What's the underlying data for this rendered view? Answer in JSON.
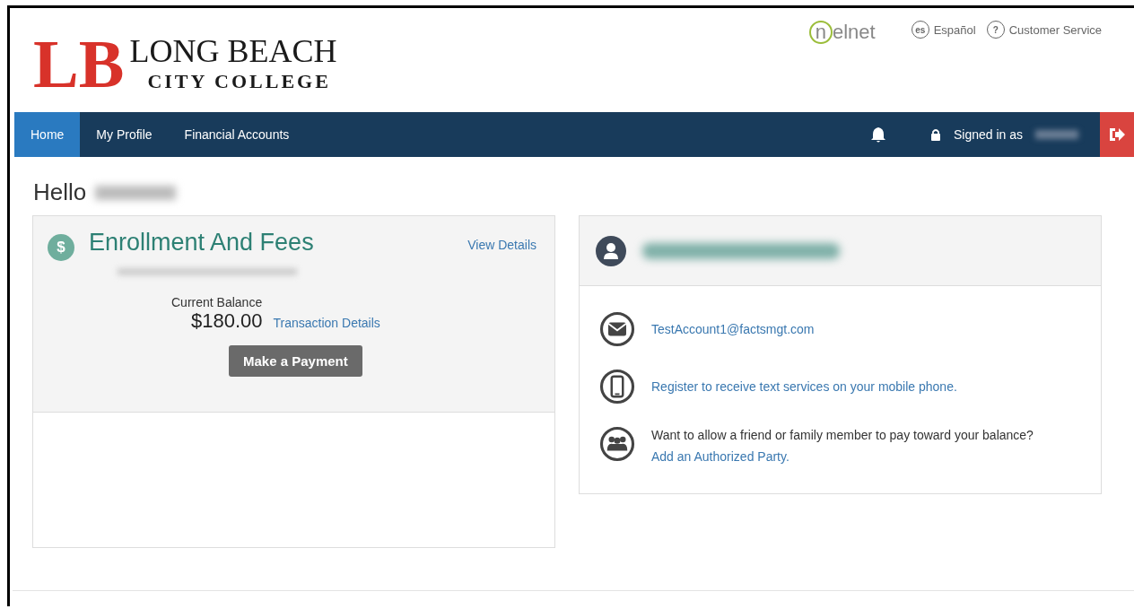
{
  "header": {
    "monogram": "LB",
    "college_name": "LONG BEACH",
    "college_sub": "CITY COLLEGE",
    "partner_logo": {
      "circle_letter": "n",
      "rest": "elnet"
    },
    "links": [
      {
        "badge": "es",
        "label": "Español"
      },
      {
        "badge": "?",
        "label": "Customer Service"
      }
    ]
  },
  "nav": {
    "items": [
      {
        "label": "Home",
        "selected": true
      },
      {
        "label": "My Profile",
        "selected": false
      },
      {
        "label": "Financial Accounts",
        "selected": false
      }
    ],
    "signed_in": "Signed in as"
  },
  "greeting": "Hello",
  "account_card": {
    "icon": "$",
    "title": "Enrollment And Fees",
    "link": "View Details",
    "balance_label": "Current Balance",
    "balance": "$180.00",
    "transactions_link": "Transaction Details",
    "pay_button": "Make a Payment"
  },
  "profile_card": {
    "items": [
      {
        "kind": "email",
        "link": "TestAccount1@factsmgt.com"
      },
      {
        "kind": "phone",
        "link": "Register to receive text services on your mobile phone."
      },
      {
        "kind": "people",
        "text": "Want to allow a friend or family member to pay toward your balance?",
        "link": "Add an Authorized Party."
      }
    ]
  }
}
